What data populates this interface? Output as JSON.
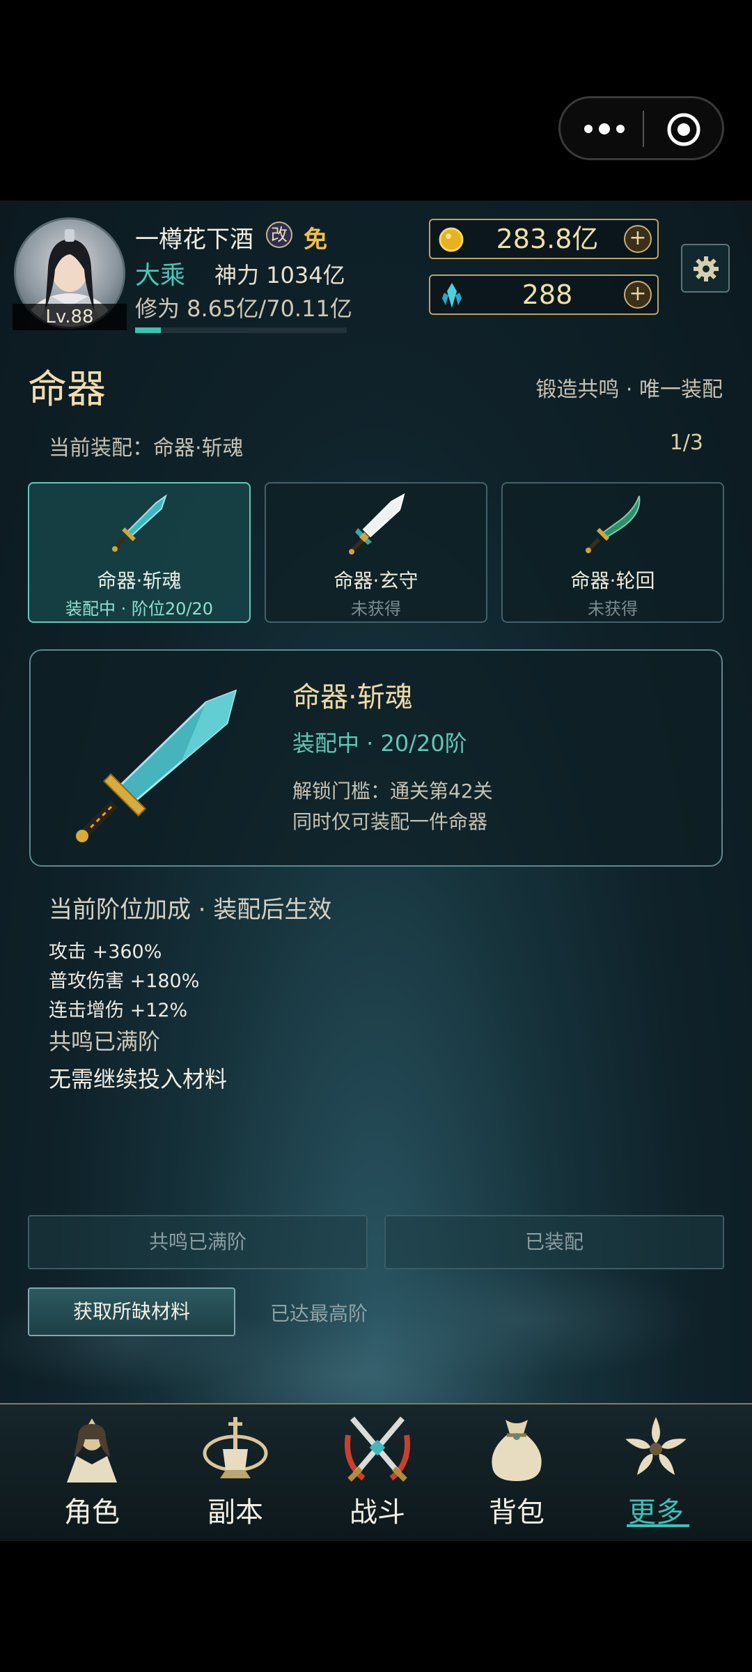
{
  "capsule": {
    "more_icon": "more-dots-icon",
    "close_icon": "target-circle-icon"
  },
  "player": {
    "name": "一樽花下酒",
    "badge_modify": "改",
    "badge_free": "免",
    "level": "Lv.88",
    "realm": "大乘",
    "power_label": "神力",
    "power_value": "1034亿",
    "cultivation": "修为 8.65亿/70.11亿",
    "cultivation_progress": 0.123
  },
  "resources": {
    "gold": {
      "icon": "gold-coin-icon",
      "value": "283.8亿",
      "plus": "+"
    },
    "crystal": {
      "icon": "crystal-icon",
      "value": "288",
      "plus": "+"
    }
  },
  "settings_icon": "gear-icon",
  "section": {
    "title": "命器",
    "subtitle": "锻造共鸣 · 唯一装配",
    "current_label": "当前装配：命器·斩魂",
    "count": "1/3"
  },
  "cards": [
    {
      "name": "命器·斩魂",
      "status": "装配中 · 阶位20/20",
      "icon": "teal-sword-icon",
      "selected": true
    },
    {
      "name": "命器·玄守",
      "status": "未获得",
      "icon": "white-sword-icon",
      "selected": false
    },
    {
      "name": "命器·轮回",
      "status": "未获得",
      "icon": "curved-blade-icon",
      "selected": false
    }
  ],
  "detail": {
    "name": "命器·斩魂",
    "status": "装配中 · 20/20阶",
    "unlock": "解锁门槛：通关第42关",
    "note": "同时仅可装配一件命器"
  },
  "bonus": {
    "header": "当前阶位加成 · 装配后生效",
    "lines": [
      "攻击 +360%",
      "普攻伤害 +180%",
      "连击增伤 +12%"
    ],
    "maxed": "共鸣已满阶",
    "no_material": "无需继续投入材料"
  },
  "buttons": {
    "resonance": "共鸣已满阶",
    "equipped": "已装配",
    "get_materials": "获取所缺材料",
    "max_rank": "已达最高阶"
  },
  "nav": [
    {
      "label": "角色",
      "icon": "character-icon"
    },
    {
      "label": "副本",
      "icon": "dungeon-icon"
    },
    {
      "label": "战斗",
      "icon": "crossed-swords-icon"
    },
    {
      "label": "背包",
      "icon": "bag-icon"
    },
    {
      "label": "更多",
      "icon": "lotus-more-icon",
      "active": true
    }
  ]
}
